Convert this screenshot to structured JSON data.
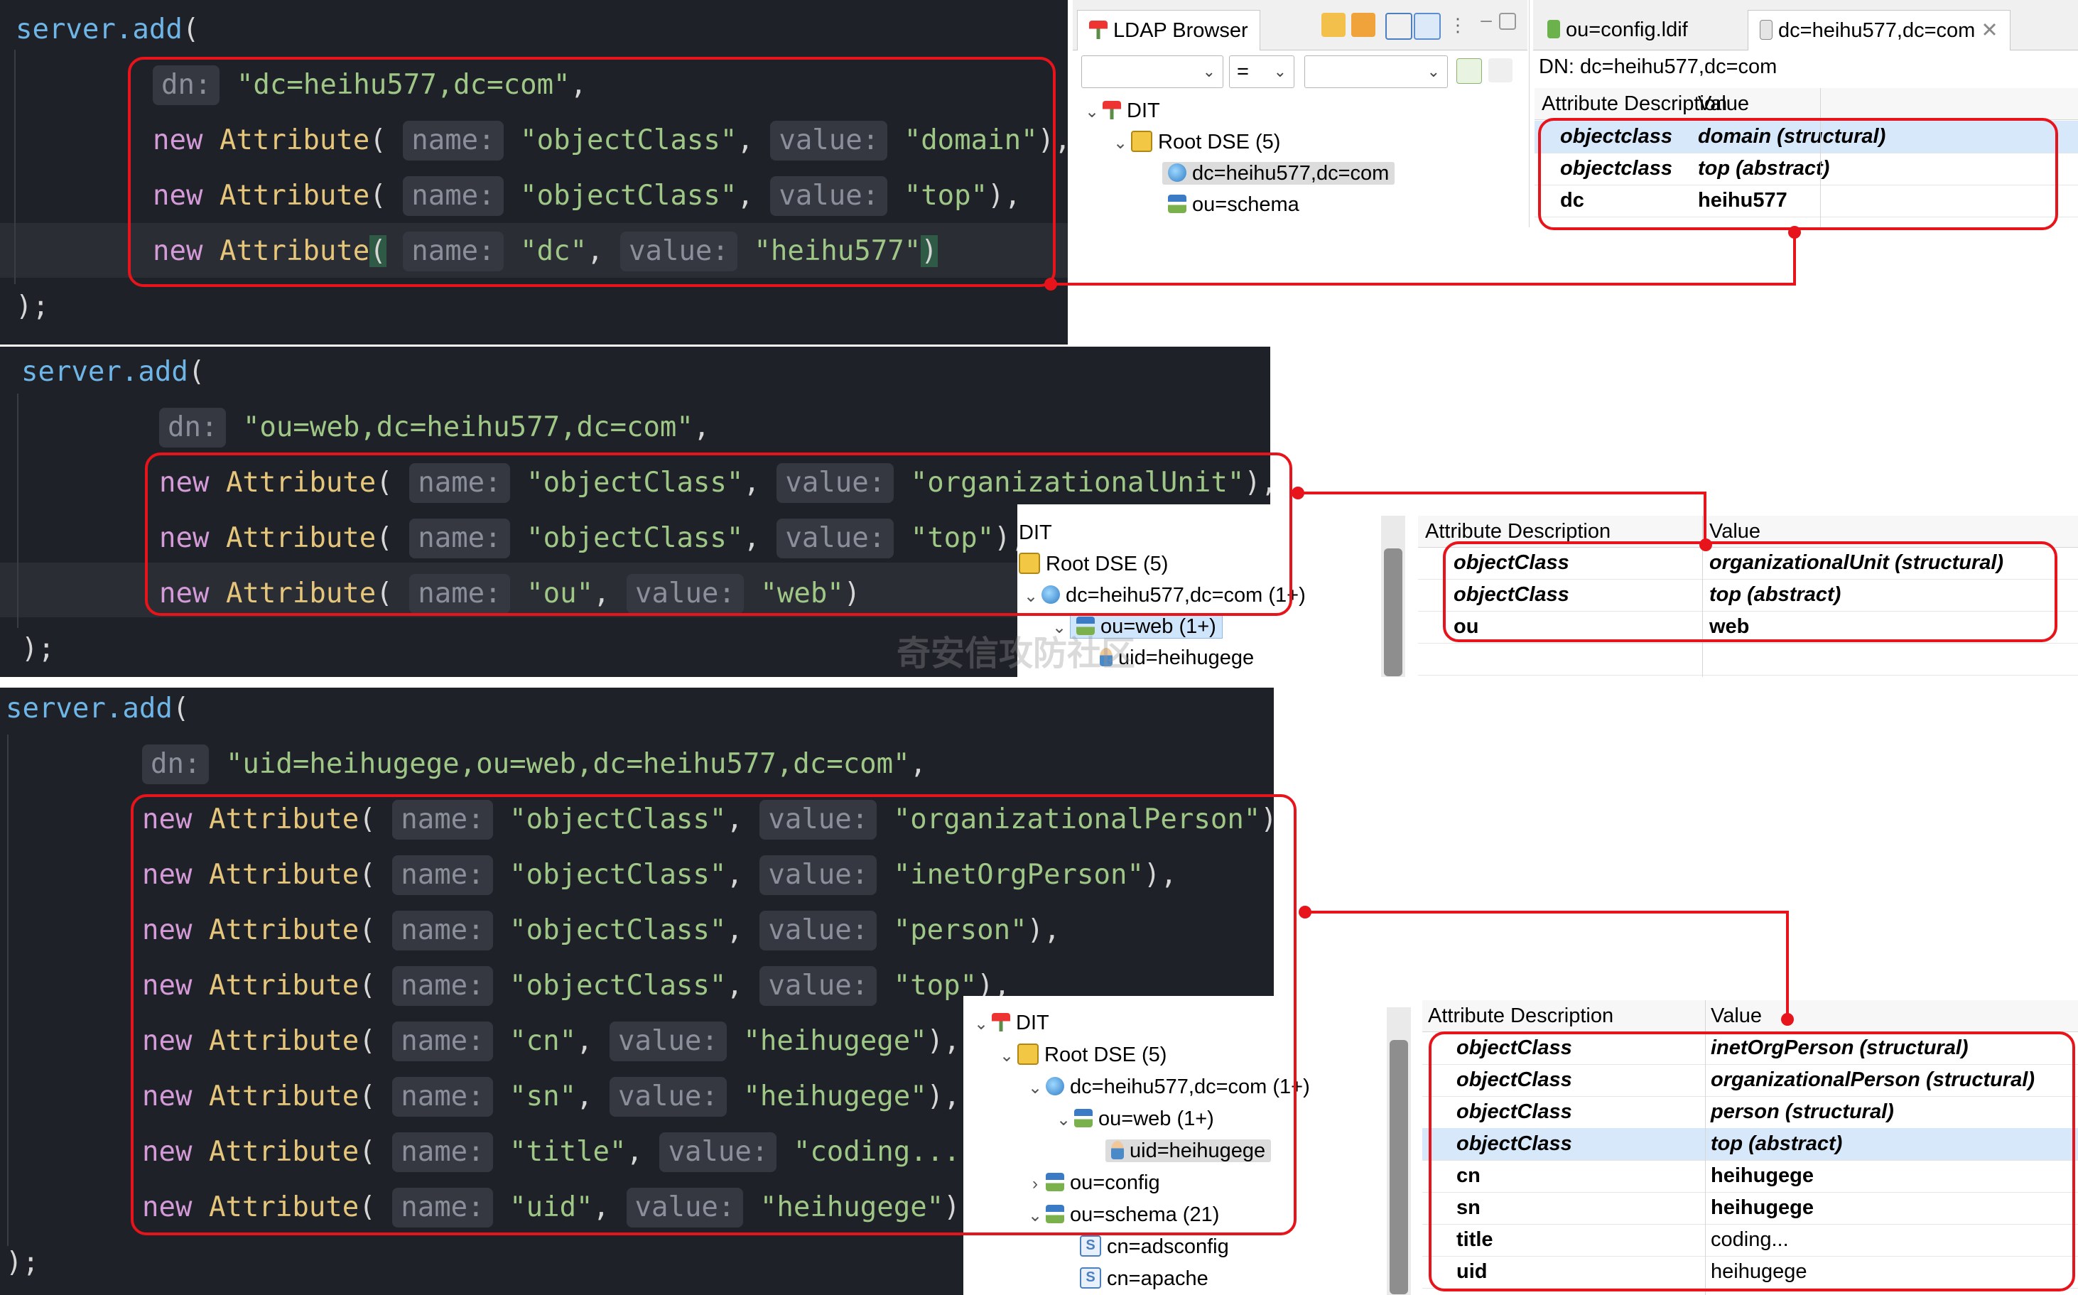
{
  "panel1": {
    "code": {
      "call_obj": "server",
      "call_method": ".add",
      "call_open": "(",
      "dn_hint": "dn:",
      "dn_value": "\"dc=heihu577,dc=com\"",
      "dn_comma": ",",
      "lines": [
        {
          "kw": "new",
          "cls": "Attribute",
          "open": "(",
          "name_hint": "name:",
          "name": "\"objectClass\"",
          "sep": ",",
          "value_hint": "value:",
          "value": "\"domain\"",
          "close": "),"
        },
        {
          "kw": "new",
          "cls": "Attribute",
          "open": "(",
          "name_hint": "name:",
          "name": "\"objectClass\"",
          "sep": ",",
          "value_hint": "value:",
          "value": "\"top\"",
          "close": "),"
        },
        {
          "kw": "new",
          "cls": "Attribute",
          "open": "(",
          "name_hint": "name:",
          "name": "\"dc\"",
          "sep": ",",
          "value_hint": "value:",
          "value": "\"heihu577\"",
          "close": ")"
        }
      ],
      "end": ");"
    },
    "browser": {
      "tab_ldap": "LDAP Browser",
      "tab_config": "ou=config.ldif",
      "tab_entry": "dc=heihu577,dc=com",
      "filter_op": "=",
      "dn_label": "DN: dc=heihu577,dc=com",
      "tree": [
        {
          "label": "DIT",
          "icon": "dit-icon"
        },
        {
          "label": "Root DSE (5)",
          "icon": "root-dse-icon"
        },
        {
          "label": "dc=heihu577,dc=com",
          "icon": "globe-icon"
        },
        {
          "label": "ou=schema",
          "icon": "ou-icon"
        }
      ],
      "col_attr": "Attribute Description",
      "col_value": "Value",
      "rows": [
        {
          "attr": "objectclass",
          "value": "domain (structural)"
        },
        {
          "attr": "objectclass",
          "value": "top (abstract)"
        },
        {
          "attr": "dc",
          "value": "heihu577"
        }
      ]
    }
  },
  "panel2": {
    "code": {
      "call_obj": "server",
      "call_method": ".add",
      "call_open": "(",
      "dn_hint": "dn:",
      "dn_value": "\"ou=web,dc=heihu577,dc=com\"",
      "dn_comma": ",",
      "lines": [
        {
          "kw": "new",
          "cls": "Attribute",
          "open": "(",
          "name_hint": "name:",
          "name": "\"objectClass\"",
          "sep": ",",
          "value_hint": "value:",
          "value": "\"organizationalUnit\"",
          "close": "),"
        },
        {
          "kw": "new",
          "cls": "Attribute",
          "open": "(",
          "name_hint": "name:",
          "name": "\"objectClass\"",
          "sep": ",",
          "value_hint": "value:",
          "value": "\"top\"",
          "close": "),"
        },
        {
          "kw": "new",
          "cls": "Attribute",
          "open": "(",
          "name_hint": "name:",
          "name": "\"ou\"",
          "sep": ",",
          "value_hint": "value:",
          "value": "\"web\"",
          "close": ")"
        }
      ],
      "end": ");"
    },
    "browser": {
      "tree": [
        {
          "label": "DIT"
        },
        {
          "label": "Root DSE (5)"
        },
        {
          "label": "dc=heihu577,dc=com (1+)"
        },
        {
          "label": "ou=web (1+)"
        },
        {
          "label": "uid=heihugege"
        }
      ],
      "col_attr": "Attribute Description",
      "col_value": "Value",
      "rows": [
        {
          "attr": "objectClass",
          "value": "organizationalUnit (structural)"
        },
        {
          "attr": "objectClass",
          "value": "top (abstract)"
        },
        {
          "attr": "ou",
          "value": "web"
        }
      ]
    },
    "watermark": "奇安信攻防社区"
  },
  "panel3": {
    "code": {
      "call_obj": "server",
      "call_method": ".add",
      "call_open": "(",
      "dn_hint": "dn:",
      "dn_value": "\"uid=heihugege,ou=web,dc=heihu577,dc=com\"",
      "dn_comma": ",",
      "lines": [
        {
          "kw": "new",
          "cls": "Attribute",
          "open": "(",
          "name_hint": "name:",
          "name": "\"objectClass\"",
          "sep": ",",
          "value_hint": "value:",
          "value": "\"organizationalPerson\"",
          "close": "),"
        },
        {
          "kw": "new",
          "cls": "Attribute",
          "open": "(",
          "name_hint": "name:",
          "name": "\"objectClass\"",
          "sep": ",",
          "value_hint": "value:",
          "value": "\"inetOrgPerson\"",
          "close": "),"
        },
        {
          "kw": "new",
          "cls": "Attribute",
          "open": "(",
          "name_hint": "name:",
          "name": "\"objectClass\"",
          "sep": ",",
          "value_hint": "value:",
          "value": "\"person\"",
          "close": "),"
        },
        {
          "kw": "new",
          "cls": "Attribute",
          "open": "(",
          "name_hint": "name:",
          "name": "\"objectClass\"",
          "sep": ",",
          "value_hint": "value:",
          "value": "\"top\"",
          "close": "),"
        },
        {
          "kw": "new",
          "cls": "Attribute",
          "open": "(",
          "name_hint": "name:",
          "name": "\"cn\"",
          "sep": ",",
          "value_hint": "value:",
          "value": "\"heihugege\"",
          "close": "),"
        },
        {
          "kw": "new",
          "cls": "Attribute",
          "open": "(",
          "name_hint": "name:",
          "name": "\"sn\"",
          "sep": ",",
          "value_hint": "value:",
          "value": "\"heihugege\"",
          "close": "),"
        },
        {
          "kw": "new",
          "cls": "Attribute",
          "open": "(",
          "name_hint": "name:",
          "name": "\"title\"",
          "sep": ",",
          "value_hint": "value:",
          "value": "\"coding...\"",
          "close": ")"
        },
        {
          "kw": "new",
          "cls": "Attribute",
          "open": "(",
          "name_hint": "name:",
          "name": "\"uid\"",
          "sep": ",",
          "value_hint": "value:",
          "value": "\"heihugege\"",
          "close": ")"
        }
      ],
      "end": ");"
    },
    "browser": {
      "tree": [
        {
          "label": "DIT"
        },
        {
          "label": "Root DSE (5)"
        },
        {
          "label": "dc=heihu577,dc=com (1+)"
        },
        {
          "label": "ou=web (1+)"
        },
        {
          "label": "uid=heihugege"
        },
        {
          "label": "ou=config"
        },
        {
          "label": "ou=schema (21)"
        },
        {
          "label": "cn=adsconfig"
        },
        {
          "label": "cn=apache"
        }
      ],
      "col_attr": "Attribute Description",
      "col_value": "Value",
      "rows": [
        {
          "attr": "objectClass",
          "value": "inetOrgPerson (structural)"
        },
        {
          "attr": "objectClass",
          "value": "organizationalPerson (structural)"
        },
        {
          "attr": "objectClass",
          "value": "person (structural)"
        },
        {
          "attr": "objectClass",
          "value": "top (abstract)"
        },
        {
          "attr": "cn",
          "value": "heihugege"
        },
        {
          "attr": "sn",
          "value": "heihugege"
        },
        {
          "attr": "title",
          "value": "coding..."
        },
        {
          "attr": "uid",
          "value": "heihugege"
        }
      ]
    }
  },
  "colors": {
    "callout": "#e8141b",
    "editor_bg": "#1f2128",
    "selection": "#d7e8fb"
  }
}
